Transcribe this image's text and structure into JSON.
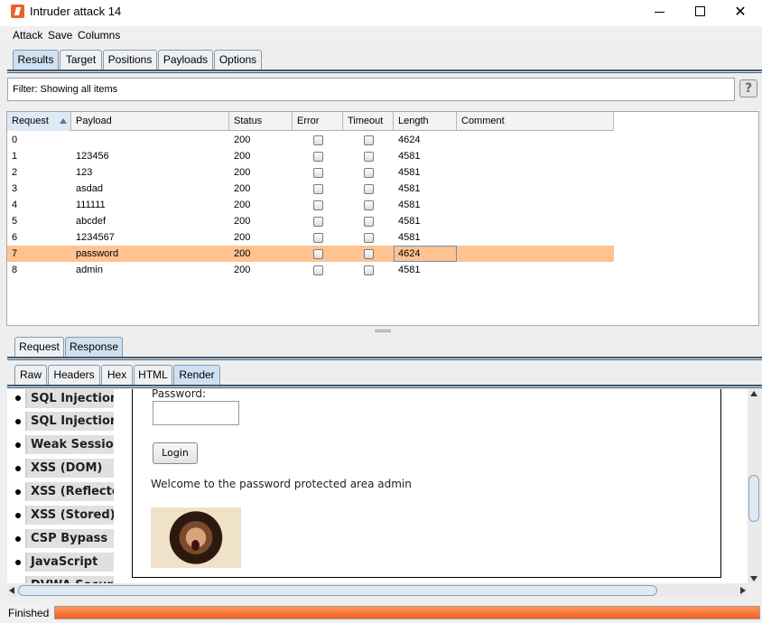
{
  "window": {
    "title": "Intruder attack 14"
  },
  "menu": {
    "items": [
      "Attack",
      "Save",
      "Columns"
    ]
  },
  "main_tabs": [
    "Results",
    "Target",
    "Positions",
    "Payloads",
    "Options"
  ],
  "active_main_tab": "Results",
  "filter": {
    "text": "Filter:  Showing all items",
    "help_label": "?"
  },
  "table": {
    "columns": [
      "Request",
      "Payload",
      "Status",
      "Error",
      "Timeout",
      "Length",
      "Comment"
    ],
    "sorted_column": "Request",
    "rows": [
      {
        "request": "0",
        "payload": "",
        "status": "200",
        "error": false,
        "timeout": false,
        "length": "4624",
        "comment": ""
      },
      {
        "request": "1",
        "payload": "123456",
        "status": "200",
        "error": false,
        "timeout": false,
        "length": "4581",
        "comment": ""
      },
      {
        "request": "2",
        "payload": "123",
        "status": "200",
        "error": false,
        "timeout": false,
        "length": "4581",
        "comment": ""
      },
      {
        "request": "3",
        "payload": "asdad",
        "status": "200",
        "error": false,
        "timeout": false,
        "length": "4581",
        "comment": ""
      },
      {
        "request": "4",
        "payload": "111111",
        "status": "200",
        "error": false,
        "timeout": false,
        "length": "4581",
        "comment": ""
      },
      {
        "request": "5",
        "payload": "abcdef",
        "status": "200",
        "error": false,
        "timeout": false,
        "length": "4581",
        "comment": ""
      },
      {
        "request": "6",
        "payload": "1234567",
        "status": "200",
        "error": false,
        "timeout": false,
        "length": "4581",
        "comment": ""
      },
      {
        "request": "7",
        "payload": "password",
        "status": "200",
        "error": false,
        "timeout": false,
        "length": "4624",
        "comment": ""
      },
      {
        "request": "8",
        "payload": "admin",
        "status": "200",
        "error": false,
        "timeout": false,
        "length": "4581",
        "comment": ""
      }
    ],
    "selected_row": 7,
    "selected_color": "#ffc391"
  },
  "message_tabs": [
    "Request",
    "Response"
  ],
  "active_message_tab": "Response",
  "view_tabs": [
    "Raw",
    "Headers",
    "Hex",
    "HTML",
    "Render"
  ],
  "active_view_tab": "Render",
  "render": {
    "sidebar_items": [
      "SQL Injection",
      "SQL Injection (",
      "Weak Session",
      "XSS (DOM)",
      "XSS (Reflected",
      "XSS (Stored)",
      "CSP Bypass",
      "JavaScript",
      "DVWA Security"
    ],
    "password_label": "Password:",
    "login_button": "Login",
    "welcome_text": "Welcome to the password protected area admin"
  },
  "status": {
    "text": "Finished",
    "progress": 1.0,
    "progress_color": "#f0601c"
  }
}
